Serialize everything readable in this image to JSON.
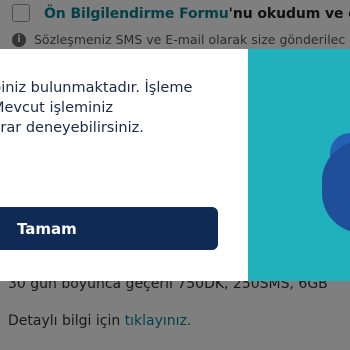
{
  "background": {
    "consent": {
      "link_text": "Ön Bilgilendirme Formu",
      "rest_text": "'nu okudum ve or"
    },
    "info_text": "Sözleşmeniz SMS ve E-mail olarak size gönderilec",
    "validity_text": "30 gün boyunca geçerli 750DK, 250SMS, 6GB",
    "details": {
      "prefix": "Detaylı bilgi için",
      "link": "tıklayınız."
    }
  },
  "modal": {
    "message_lines": [
      "biniz bulunmaktadır. İşleme",
      "Mevcut işleminiz",
      "krar deneyebilirsiniz."
    ],
    "button_label": "Tamam"
  },
  "colors": {
    "overlay": "rgba(0,0,0,0.5)",
    "button": "#0f2a54",
    "accent_panel": "#20b1bd",
    "link": "#0a7e8c"
  }
}
